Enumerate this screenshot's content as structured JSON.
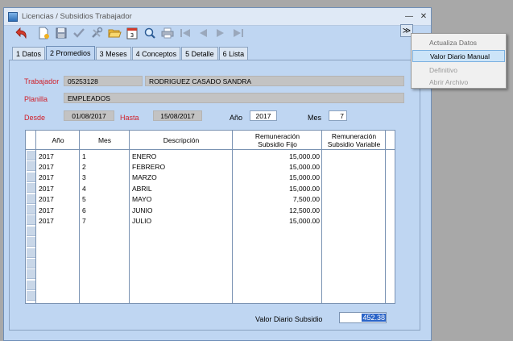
{
  "window": {
    "title": "Licencias / Subsidios Trabajador"
  },
  "toolbar": {
    "buttons": [
      "undo-icon",
      "new-document-icon",
      "save-icon",
      "check-icon",
      "tools-icon",
      "folder-open-icon",
      "calendar-icon",
      "search-icon",
      "print-icon",
      "first-icon",
      "prev-icon",
      "next-icon",
      "last-icon"
    ],
    "more_label": "≫"
  },
  "tabs": [
    {
      "label": "1 Datos"
    },
    {
      "label": "2 Promedios"
    },
    {
      "label": "3 Meses"
    },
    {
      "label": "4 Conceptos"
    },
    {
      "label": "5 Detalle"
    },
    {
      "label": "6 Lista"
    }
  ],
  "active_tab": "2 Promedios",
  "form": {
    "trabajador_label": "Trabajador",
    "trabajador_code": "05253128",
    "trabajador_name": "RODRIGUEZ CASADO SANDRA",
    "planilla_label": "Planilla",
    "planilla_value": "EMPLEADOS",
    "desde_label": "Desde",
    "desde_value": "01/08/2017",
    "hasta_label": "Hasta",
    "hasta_value": "15/08/2017",
    "anio_label": "Año",
    "anio_value": "2017",
    "mes_label": "Mes",
    "mes_value": "7"
  },
  "grid": {
    "headers": [
      "Año",
      "Mes",
      "Descripción",
      "Remuneración\nSubsidio Fijo",
      "Remuneración\nSubsidio Variable"
    ],
    "rows": [
      {
        "anio": "2017",
        "mes": "1",
        "desc": "ENERO",
        "fijo": "15,000.00",
        "variable": ""
      },
      {
        "anio": "2017",
        "mes": "2",
        "desc": "FEBRERO",
        "fijo": "15,000.00",
        "variable": ""
      },
      {
        "anio": "2017",
        "mes": "3",
        "desc": "MARZO",
        "fijo": "15,000.00",
        "variable": ""
      },
      {
        "anio": "2017",
        "mes": "4",
        "desc": "ABRIL",
        "fijo": "15,000.00",
        "variable": ""
      },
      {
        "anio": "2017",
        "mes": "5",
        "desc": "MAYO",
        "fijo": "7,500.00",
        "variable": ""
      },
      {
        "anio": "2017",
        "mes": "6",
        "desc": "JUNIO",
        "fijo": "12,500.00",
        "variable": ""
      },
      {
        "anio": "2017",
        "mes": "7",
        "desc": "JULIO",
        "fijo": "15,000.00",
        "variable": ""
      }
    ]
  },
  "summary": {
    "label": "Valor Diario Subsidio",
    "value": "452.38"
  },
  "context_menu": {
    "items": [
      {
        "label": "Actualiza Datos",
        "state": "normal"
      },
      {
        "label": "Valor Diario Manual",
        "state": "highlighted"
      },
      {
        "label": "Definitivo",
        "state": "disabled"
      },
      {
        "label": "Abrir Archivo",
        "state": "disabled"
      }
    ]
  },
  "colors": {
    "accent_red": "#d0202a",
    "window_bg": "#bfd6f2",
    "selection_blue": "#2a64c8"
  }
}
